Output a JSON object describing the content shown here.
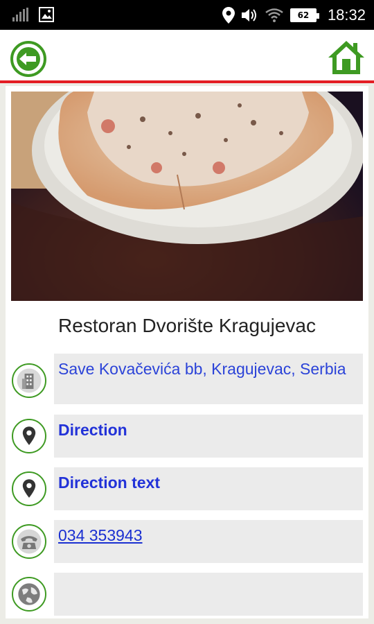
{
  "status": {
    "battery": "62",
    "time": "18:32"
  },
  "restaurant": {
    "name": "Restoran Dvorište Kragujevac",
    "address": "Save Kovačevića bb, Kragujevac, Serbia",
    "direction": "Direction",
    "direction_text": "Direction text",
    "phone": "034 353943",
    "website": ""
  },
  "icons": {
    "back": "back-arrow-icon",
    "home": "home-icon",
    "address": "building-icon",
    "direction": "map-pin-icon",
    "direction_text": "map-pin-icon",
    "phone": "telephone-icon",
    "website": "globe-icon"
  },
  "colors": {
    "accent_green": "#3e9a22",
    "divider_red": "#e31e24",
    "link_blue": "#2b43d8"
  }
}
